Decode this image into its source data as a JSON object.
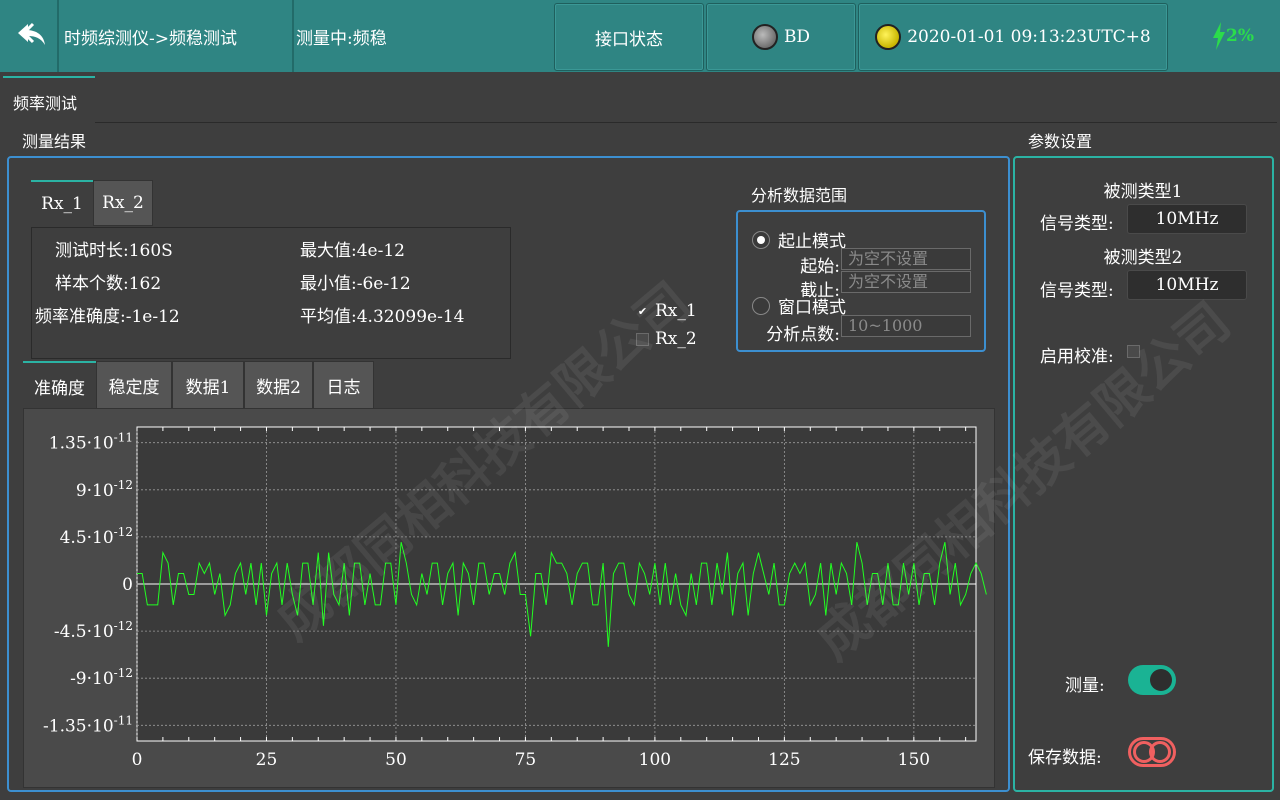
{
  "header": {
    "breadcrumb": "时频综测仪->频稳测试",
    "status": "测量中:频稳",
    "interface_button": "接口状态",
    "bd_label": "BD",
    "datetime": "2020-01-01 09:13:23UTC+8",
    "battery": "2%",
    "colors": {
      "bar": "#2f8583",
      "battery": "#2bdc4b"
    }
  },
  "main_tab": {
    "label": "频率测试"
  },
  "results": {
    "title": "测量结果",
    "tabs": [
      "Rx_1",
      "Rx_2"
    ],
    "active_tab": "Rx_1",
    "stats": {
      "duration_label": "测试时长:",
      "duration": "160S",
      "samples_label": "样本个数:",
      "samples": "162",
      "accuracy_label": "频率准确度:",
      "accuracy": "-1e-12",
      "max_label": "最大值:",
      "max": "4e-12",
      "min_label": "最小值:",
      "min": "-6e-12",
      "mean_label": "平均值:",
      "mean": "4.32099e-14"
    },
    "checks": [
      {
        "label": "Rx_1",
        "checked": true
      },
      {
        "label": "Rx_2",
        "checked": false
      }
    ]
  },
  "range": {
    "title": "分析数据范围",
    "mode_start_stop": "起止模式",
    "start_label": "起始:",
    "start_placeholder": "为空不设置",
    "stop_label": "截止:",
    "stop_placeholder": "为空不设置",
    "mode_window": "窗口模式",
    "points_label": "分析点数:",
    "points_placeholder": "10~1000"
  },
  "bottom_tabs": [
    "准确度",
    "稳定度",
    "数据1",
    "数据2",
    "日志"
  ],
  "params": {
    "title": "参数设置",
    "type1_title": "被测类型1",
    "signal_label_1": "信号类型:",
    "signal_value_1": "10MHz",
    "type2_title": "被测类型2",
    "signal_label_2": "信号类型:",
    "signal_value_2": "10MHz",
    "calib_label": "启用校准:",
    "measure_label": "测量:",
    "save_label": "保存数据:"
  },
  "watermark": "成都同相科技有限公司",
  "chart_data": {
    "type": "line",
    "xlim": [
      0,
      162
    ],
    "ylim": [
      -1.5e-11,
      1.5e-11
    ],
    "xticks": [
      0,
      25,
      50,
      75,
      100,
      125,
      150
    ],
    "yticks": [
      {
        "value": 1.35e-11,
        "mant": "1.35·10",
        "exp": "-11"
      },
      {
        "value": 9e-12,
        "mant": "9·10",
        "exp": "-12"
      },
      {
        "value": 4.5e-12,
        "mant": "4.5·10",
        "exp": "-12"
      },
      {
        "value": 0,
        "mant": "0",
        "exp": ""
      },
      {
        "value": -4.5e-12,
        "mant": "-4.5·10",
        "exp": "-12"
      },
      {
        "value": -9e-12,
        "mant": "-9·10",
        "exp": "-12"
      },
      {
        "value": -1.35e-11,
        "mant": "-1.35·10",
        "exp": "-11"
      }
    ],
    "grid": true,
    "line_color": "#22ff22",
    "series": [
      {
        "values": [
          1e-12,
          1e-12,
          -2e-12,
          -2e-12,
          -2e-12,
          3e-12,
          2e-12,
          -2e-12,
          1e-12,
          1e-12,
          -1e-12,
          -1e-12,
          2e-12,
          1e-12,
          2e-12,
          -1e-12,
          1e-12,
          -3e-12,
          -2e-12,
          1e-12,
          2e-12,
          -1e-12,
          2e-12,
          -2e-12,
          2e-12,
          -3e-12,
          1e-12,
          2e-12,
          -2e-12,
          2e-12,
          -1e-12,
          -3e-12,
          2e-12,
          2e-12,
          -2e-12,
          3e-12,
          -4e-12,
          3e-12,
          -1e-12,
          -2e-12,
          2e-12,
          -3e-12,
          2e-12,
          2e-12,
          -2e-12,
          1e-12,
          -2e-12,
          -2e-12,
          2e-12,
          2e-12,
          -2e-12,
          4e-12,
          2e-12,
          -1e-12,
          -2e-12,
          1e-12,
          -1e-12,
          2e-12,
          2e-12,
          -2e-12,
          1e-12,
          2e-12,
          -3e-12,
          2e-12,
          1e-12,
          -2e-12,
          2e-12,
          2e-12,
          -1e-12,
          1e-12,
          1e-12,
          -1e-12,
          2e-12,
          3e-12,
          -1e-12,
          -1e-12,
          -5e-12,
          1e-12,
          1e-12,
          -2e-12,
          3e-12,
          2e-12,
          2e-12,
          1e-12,
          -2e-12,
          1e-12,
          2e-12,
          2e-12,
          -2e-12,
          -2e-12,
          2e-12,
          -6e-12,
          1e-12,
          2e-12,
          2e-12,
          -1e-12,
          -2e-12,
          2e-12,
          1e-12,
          -1e-12,
          2e-12,
          -2e-12,
          2e-12,
          -2e-12,
          1e-12,
          -2e-12,
          -3e-12,
          1e-12,
          -2e-12,
          2e-12,
          2e-12,
          -2e-12,
          2e-12,
          -1e-12,
          3e-12,
          -3e-12,
          1e-12,
          2e-12,
          -3e-12,
          1e-12,
          3e-12,
          1e-12,
          -1e-12,
          2e-12,
          -2e-12,
          -2e-12,
          1e-12,
          2e-12,
          1e-12,
          2e-12,
          -2e-12,
          -1e-12,
          2e-12,
          -3e-12,
          2e-12,
          -1e-12,
          2e-12,
          1e-12,
          -2e-12,
          4e-12,
          2e-12,
          -2e-12,
          1e-12,
          1e-12,
          -2e-12,
          2e-12,
          -2e-12,
          -2e-12,
          2e-12,
          -1e-12,
          2e-12,
          -2e-12,
          1e-12,
          1e-12,
          -2e-12,
          2e-12,
          4e-12,
          -1e-12,
          2e-12,
          -2e-12,
          -1e-12,
          1e-12,
          2e-12,
          1e-12,
          -1e-12
        ]
      }
    ]
  }
}
